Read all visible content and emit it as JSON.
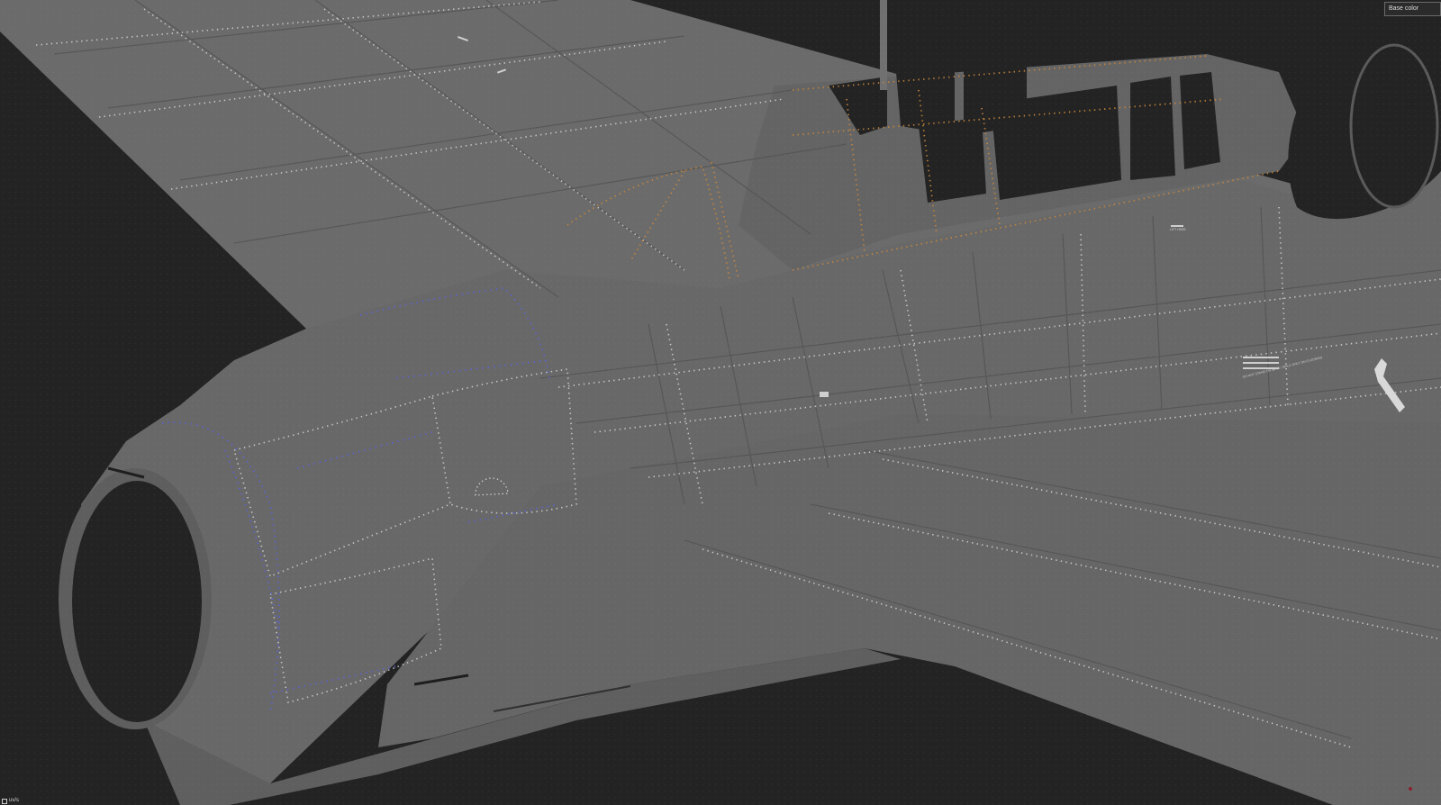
{
  "viewport": {
    "channel_selector": {
      "selected": "Base color"
    },
    "status": {
      "label": "uv/s"
    },
    "colors": {
      "background": "#232323",
      "surface": "#6b6b6b",
      "surface_shadow": "#5c5c5c",
      "panel_line": "#535353",
      "rivet_white": "#d8d8d8",
      "rivet_orange": "#c8873a",
      "rivet_blue": "#5a63e0"
    },
    "decals": {
      "text": "DO NOT STAND ON WING / WALK ONLY ON FLOORING",
      "small_label": "LIFT HERE"
    }
  }
}
